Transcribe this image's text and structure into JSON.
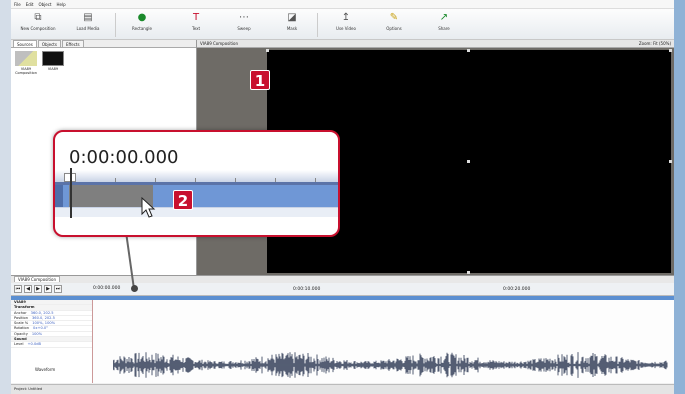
{
  "menu": [
    "File",
    "Edit",
    "Object",
    "Help"
  ],
  "toolbar": [
    {
      "label": "New Composition",
      "icon": "new-composition-icon",
      "glyph": "⧉"
    },
    {
      "label": "Load Media",
      "icon": "load-media-icon",
      "glyph": "▤"
    },
    {
      "label": "Rectangle",
      "icon": "rectangle-icon",
      "glyph": "●"
    },
    {
      "label": "Text",
      "icon": "text-icon",
      "glyph": "T"
    },
    {
      "label": "Sweep",
      "icon": "sweep-icon",
      "glyph": "⋯"
    },
    {
      "label": "Mask",
      "icon": "mask-icon",
      "glyph": "◪"
    },
    {
      "label": "Use Video",
      "icon": "use-video-icon",
      "glyph": "↥"
    },
    {
      "label": "Options",
      "icon": "options-icon",
      "glyph": "✎"
    },
    {
      "label": "Share",
      "icon": "share-icon",
      "glyph": "↗"
    }
  ],
  "left_panel": {
    "tabs": [
      "Sources",
      "Objects",
      "Effects"
    ],
    "items": [
      {
        "label": "VIA89 Composition"
      },
      {
        "label": "VIA89"
      }
    ]
  },
  "stage": {
    "title": "VIA89 Composition",
    "zoom": "Zoom: Fit (50%)"
  },
  "badges": [
    "1",
    "2"
  ],
  "timeline": {
    "tab": "VIA89 Composition",
    "timecode": "0:00:00.000",
    "ruler_labels": [
      "0:00:10.000",
      "0:00:20.000"
    ]
  },
  "tracks": [
    {
      "name": "VIA89",
      "value": "",
      "group": true
    },
    {
      "name": "Transform",
      "value": "",
      "group": true
    },
    {
      "name": "Anchor",
      "value": "360.0, 202.5"
    },
    {
      "name": "Position",
      "value": "360.0, 202.5"
    },
    {
      "name": "Scale %",
      "value": "100%, 100%"
    },
    {
      "name": "Rotation",
      "value": "0x+0.0°"
    },
    {
      "name": "Opacity",
      "value": "100%"
    },
    {
      "name": "Sound",
      "value": "",
      "group": true
    },
    {
      "name": "Level",
      "value": "+0.0dB"
    }
  ],
  "waveform_label": "Waveform",
  "status": "Project: Untitled",
  "zoom_callout": {
    "timecode": "0:00:00.000"
  },
  "colors": {
    "accent_red": "#c8102e",
    "track_blue": "#6f97d6",
    "stage_black": "#000000"
  }
}
